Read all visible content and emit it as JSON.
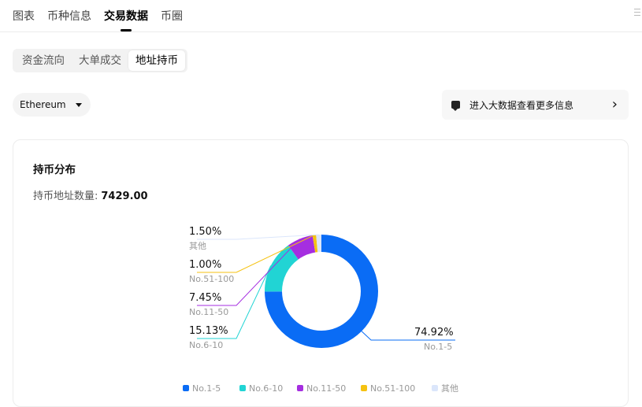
{
  "tabs": [
    {
      "label": "图表",
      "active": false
    },
    {
      "label": "币种信息",
      "active": false
    },
    {
      "label": "交易数据",
      "active": true
    },
    {
      "label": "币圈",
      "active": false
    }
  ],
  "segments": [
    {
      "label": "资金流向",
      "active": false
    },
    {
      "label": "大单成交",
      "active": false
    },
    {
      "label": "地址持币",
      "active": true
    }
  ],
  "chain_select": {
    "value": "Ethereum"
  },
  "bigdata_link": {
    "label": "进入大数据查看更多信息"
  },
  "card": {
    "title": "持币分布",
    "count_label": "持币地址数量:",
    "count_value": "7429.00"
  },
  "colors": {
    "accent": "#0a6cf5"
  },
  "chart_data": {
    "type": "pie",
    "variant": "donut",
    "title": "持币分布",
    "slices": [
      {
        "name": "No.1-5",
        "value": 74.92,
        "pct_label": "74.92%",
        "color": "#0a6cf5"
      },
      {
        "name": "No.6-10",
        "value": 15.13,
        "pct_label": "15.13%",
        "color": "#21d4d4"
      },
      {
        "name": "No.11-50",
        "value": 7.45,
        "pct_label": "7.45%",
        "color": "#a52ee0"
      },
      {
        "name": "No.51-100",
        "value": 1.0,
        "pct_label": "1.00%",
        "color": "#f5c211"
      },
      {
        "name": "其他",
        "value": 1.5,
        "pct_label": "1.50%",
        "color": "#dbe6fb"
      }
    ],
    "legend_position": "bottom"
  }
}
